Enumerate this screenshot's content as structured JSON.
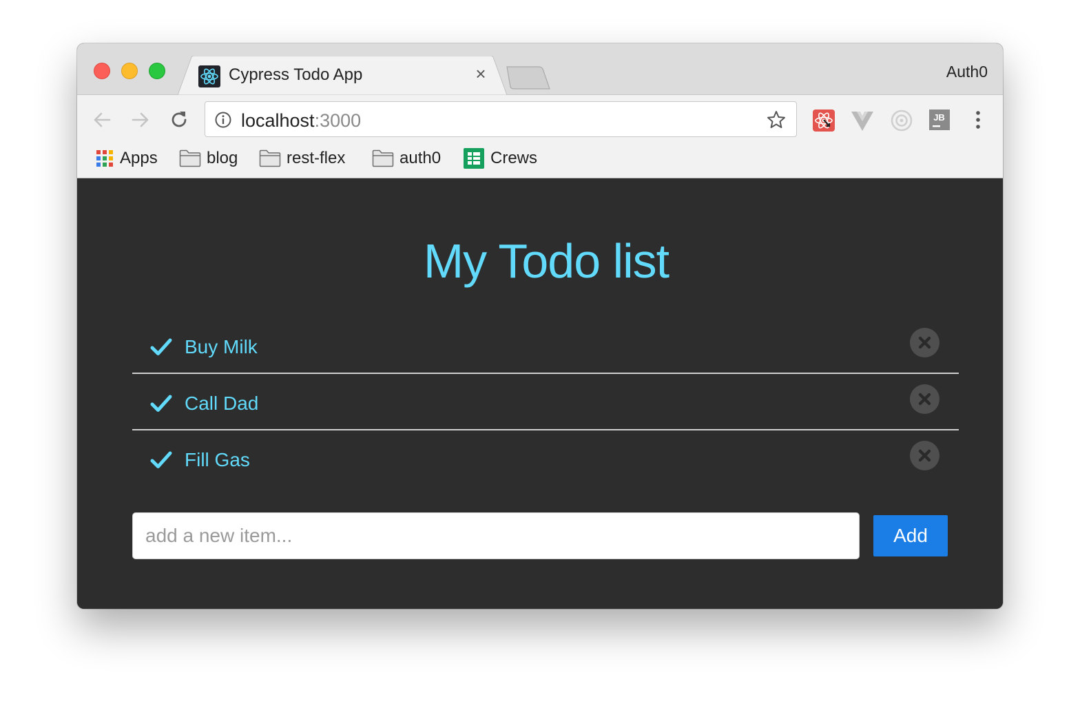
{
  "browser": {
    "tab_title": "Cypress Todo App",
    "tab_favicon": "react-icon",
    "tab_close": "×",
    "profile_name": "Auth0",
    "url_host": "localhost",
    "url_port": ":3000",
    "bookmarks": [
      {
        "label": "Apps",
        "icon": "apps-grid-icon"
      },
      {
        "label": "blog",
        "icon": "folder-icon"
      },
      {
        "label": "rest-flex",
        "icon": "folder-icon"
      },
      {
        "label": "auth0",
        "icon": "folder-icon"
      },
      {
        "label": "Crews",
        "icon": "sheets-icon"
      }
    ],
    "extensions": [
      "react-devtools-icon",
      "vue-devtools-icon",
      "circle-extension-icon",
      "jetbrains-icon"
    ],
    "jb_label": "JB"
  },
  "app": {
    "title": "My Todo list",
    "todos": [
      {
        "text": "Buy Milk",
        "done": true
      },
      {
        "text": "Call Dad",
        "done": true
      },
      {
        "text": "Fill Gas",
        "done": true
      }
    ],
    "input_placeholder": "add a new item...",
    "add_button_label": "Add"
  },
  "colors": {
    "accent": "#61dafb",
    "background": "#2d2d2d",
    "button": "#1a7ee6"
  }
}
